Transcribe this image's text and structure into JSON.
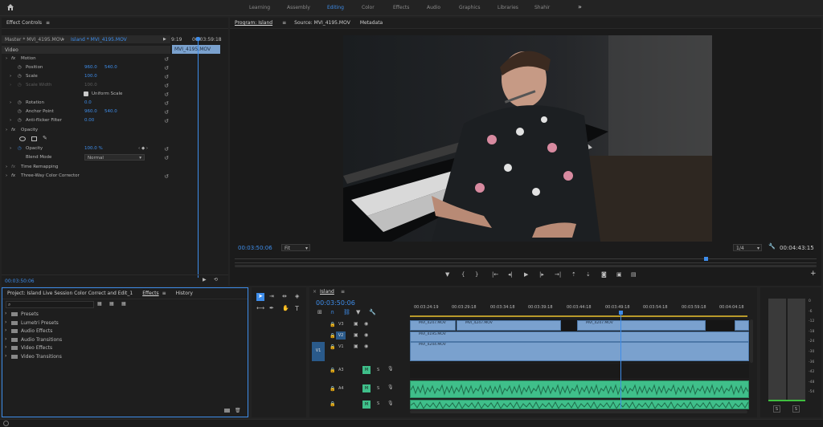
{
  "topbar": {
    "workspaces": [
      "Learning",
      "Assembly",
      "Editing",
      "Color",
      "Effects",
      "Audio",
      "Graphics",
      "Libraries",
      "Shahir"
    ],
    "active": "Editing",
    "more": "»"
  },
  "effect_controls": {
    "title": "Effect Controls",
    "menu": "≡",
    "master_label": "Master * MVI_4195.MOV",
    "sequence_label": "Island * MVI_4195.MOV",
    "time_start": "9:19",
    "time_end": "00:03:59:18",
    "clip_label": "MVI_4195.MOV",
    "video_label": "Video",
    "motion": "Motion",
    "position": "Position",
    "position_x": "960.0",
    "position_y": "540.0",
    "scale": "Scale",
    "scale_val": "100.0",
    "scale_width": "Scale Width",
    "scale_width_val": "100.0",
    "uniform_scale": "Uniform Scale",
    "rotation": "Rotation",
    "rotation_val": "0.0",
    "anchor": "Anchor Point",
    "anchor_x": "960.0",
    "anchor_y": "540.0",
    "antiflicker": "Anti-flicker Filter",
    "antiflicker_val": "0.00",
    "opacity_group": "Opacity",
    "opacity": "Opacity",
    "opacity_val": "100.0 %",
    "blend": "Blend Mode",
    "blend_val": "Normal",
    "time_remap": "Time Remapping",
    "color_corrector": "Three-Way Color Corrector",
    "timecode": "00:03:50:06"
  },
  "program": {
    "tabs": [
      "Program: Island",
      "Source: MVI_4195.MOV",
      "Metadata"
    ],
    "timecode": "00:03:50:06",
    "fit": "Fit",
    "quality": "1/4",
    "duration": "00:04:43:15"
  },
  "project": {
    "tabs": [
      "Project: Island Live Session Color Correct and Edit_1",
      "Effects",
      "History"
    ],
    "items": [
      "Presets",
      "Lumetri Presets",
      "Audio Effects",
      "Audio Transitions",
      "Video Effects",
      "Video Transitions"
    ]
  },
  "timeline": {
    "tab": "Island",
    "timecode": "00:03:50:06",
    "ruler": [
      "00:03:24:19",
      "00:03:29:18",
      "00:03:34:18",
      "00:03:39:18",
      "00:03:44:18",
      "00:03:49:18",
      "00:03:54:18",
      "00:03:59:18",
      "00:04:04:18"
    ],
    "tracks_video": [
      "V3",
      "V2",
      "V1"
    ],
    "source_v1": "V1",
    "tracks_audio": [
      "A3",
      "A4",
      ""
    ],
    "clips": [
      "MVI_4247.MOV",
      "MVI_4247.MOV",
      "MVI_4247.MOV",
      "MVI_4195.MOV",
      "MVI_4244.MOV"
    ],
    "m": "M",
    "s": "S"
  },
  "meter": {
    "scale": [
      "0",
      "-6",
      "-12",
      "-18",
      "-24",
      "-30",
      "-36",
      "-42",
      "-48",
      "-54"
    ],
    "solo_l": "S",
    "solo_r": "S"
  }
}
